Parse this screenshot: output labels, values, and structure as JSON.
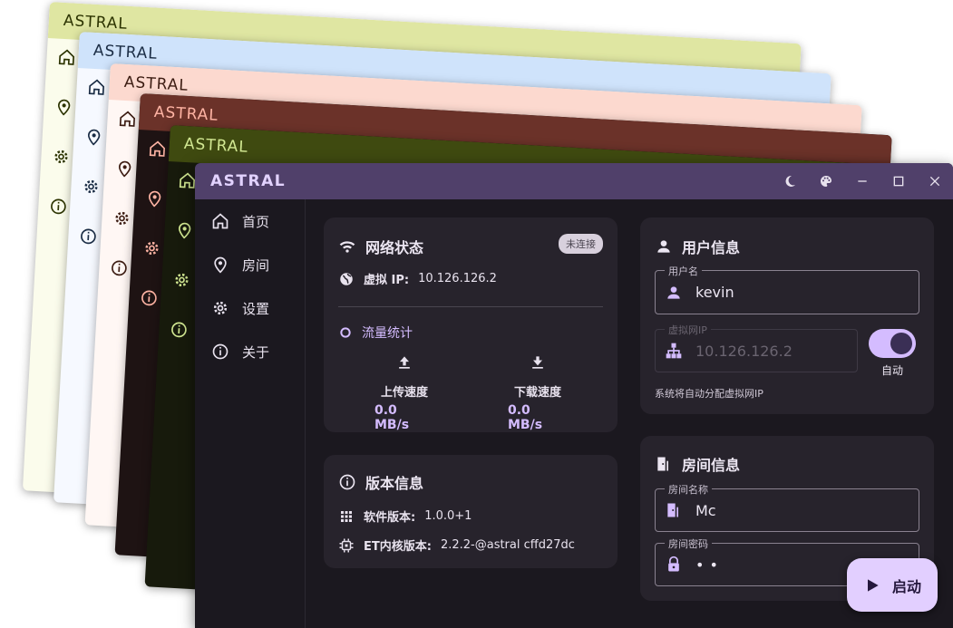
{
  "app": {
    "title": "ASTRAL"
  },
  "themes": [
    {
      "title": "ASTRAL",
      "bar": "#dfe6a2",
      "body": "#fbfcec",
      "text": "#2c3300"
    },
    {
      "title": "ASTRAL",
      "bar": "#cfe3fb",
      "body": "#f6f9ff",
      "text": "#1a2c44"
    },
    {
      "title": "ASTRAL",
      "bar": "#fcd9cf",
      "body": "#fff7f4",
      "text": "#3c1c12"
    },
    {
      "title": "ASTRAL",
      "bar": "#6b3229",
      "body": "#1e1313",
      "text": "#ffb4a4"
    },
    {
      "title": "ASTRAL",
      "bar": "#3f4a10",
      "body": "#171a0c",
      "text": "#d2e892"
    }
  ],
  "sidebar": {
    "items": [
      {
        "label": "首页",
        "icon": "home-icon"
      },
      {
        "label": "房间",
        "icon": "location-pin-icon"
      },
      {
        "label": "设置",
        "icon": "gear-icon"
      },
      {
        "label": "关于",
        "icon": "info-icon"
      }
    ]
  },
  "network": {
    "title": "网络状态",
    "badge": "未连接",
    "ip_label": "虚拟 IP:",
    "ip_value": "10.126.126.2",
    "traffic_title": "流量统计",
    "upload_label": "上传速度",
    "upload_value": "0.0 MB/s",
    "download_label": "下载速度",
    "download_value": "0.0 MB/s"
  },
  "version": {
    "title": "版本信息",
    "software_label": "软件版本:",
    "software_value": "1.0.0+1",
    "core_label": "ET内核版本:",
    "core_value": "2.2.2-@astral cffd27dc"
  },
  "user": {
    "title": "用户信息",
    "username_label": "用户名",
    "username_value": "kevin",
    "vip_label": "虚拟网IP",
    "vip_value": "10.126.126.2",
    "auto_label": "自动",
    "auto_on": true,
    "hint": "系统将自动分配虚拟网IP"
  },
  "room": {
    "title": "房间信息",
    "name_label": "房间名称",
    "name_value": "Mc",
    "password_label": "房间密码",
    "password_value": "••"
  },
  "start_button": {
    "label": "启动"
  },
  "colors": {
    "accent": "#d4bcff",
    "titlebar": "#50406a",
    "surface": "#27232c",
    "background": "#1b181f"
  }
}
